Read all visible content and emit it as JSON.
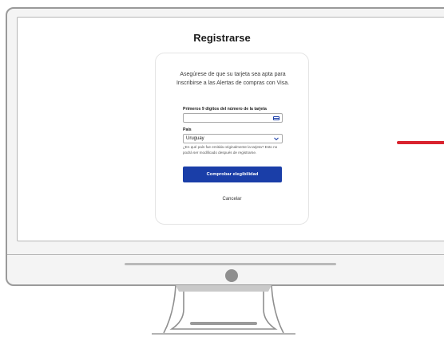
{
  "page": {
    "title": "Registrarse"
  },
  "form": {
    "intro": "Asegúrese de que su tarjeta sea apta para Inscribirse a las Alertas de compras con Visa.",
    "card_digits_label": "Primeros 9 dígitos del número de la tarjeta",
    "card_digits_value": "",
    "country_label": "País",
    "country_value": "Uruguay",
    "help_text": "¿En qué país fue emitida originalmente la tarjeta? Esto no podrá ser modificado después de registrarse.",
    "check_button": "Comprobar elegibilidad",
    "cancel_link": "Cancelar"
  },
  "colors": {
    "primary": "#1a3ea8",
    "accent": "#d9232e"
  },
  "icons": {
    "card": "credit-card-icon",
    "dropdown": "chevron-down-icon"
  }
}
